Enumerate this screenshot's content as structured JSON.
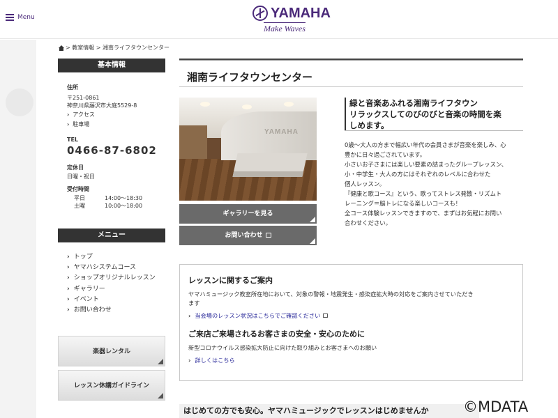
{
  "header": {
    "menu_label": "Menu",
    "logo_text": "YAMAHA",
    "logo_tagline": "Make Waves"
  },
  "breadcrumb": {
    "text": "> 教室情報 > 湘南ライフタウンセンター"
  },
  "basic_info": {
    "heading": "基本情報",
    "address_label": "住所",
    "postal": "〒251-0861",
    "address": "神奈川県藤沢市大庭5529-8",
    "access_link": "アクセス",
    "parking_link": "駐車場",
    "tel_label": "TEL",
    "tel": "0466-87-6802",
    "holiday_label": "定休日",
    "holiday": "日曜・祝日",
    "hours_label": "受付時間",
    "hours": [
      {
        "day": "平日",
        "time": "14:00〜18:30"
      },
      {
        "day": "土曜",
        "time": "10:00〜18:00"
      }
    ]
  },
  "menu": {
    "heading": "メニュー",
    "items": [
      "トップ",
      "ヤマハシステムコース",
      "ショップオリジナルレッスン",
      "ギャラリー",
      "イベント",
      "お問い合わせ"
    ]
  },
  "side_buttons": {
    "rental": "楽器レンタル",
    "guideline": "レッスン休講ガイドライン"
  },
  "main": {
    "title": "湘南ライフタウンセンター",
    "photo_logo": "YAMAHA",
    "gallery_button": "ギャラリーを見る",
    "contact_button": "お問い合わせ",
    "catch_lines": [
      "緑と音楽あふれる湘南ライフタウン",
      "リラックスしてのびのびと音楽の時間を楽",
      "しめます。"
    ],
    "description": [
      "0歳〜大人の方まで幅広い年代の会員さまが音楽を楽しみ、心",
      "豊かに日々過ごされています。",
      "小さいお子さまには楽しい要素の詰まったグループレッスン、",
      "小・中学生・大人の方にはそれぞれのレベルに合わせた",
      "個人レッスン。",
      "『健康と歌コース』という、歌ってストレス発散・リズムト",
      "レーニング＝脳トレになる楽しいコースも！",
      "全コース体験レッスンできますので、まずはお気軽にお問い",
      "合わせください。"
    ]
  },
  "notice": {
    "heading1": "レッスンに関するご案内",
    "text1": "ヤマハミュージック教室所在地において、対象の警報・地震発生・感染症拡大時の対応をご案内させていただき",
    "text1b": "ます",
    "link1": "当会場のレッスン状況はこちらでご確認ください",
    "heading2": "ご来店ご来場されるお客さまの安全・安心のために",
    "text2": "新型コロナウイルス感染拡大防止に向けた取り組みとお客さまへのお願い",
    "link2": "詳しくはこちら"
  },
  "bottom_banner": "はじめての方でも安心。ヤマハミュージックでレッスンはじめませんか",
  "watermark": "©MDATA"
}
